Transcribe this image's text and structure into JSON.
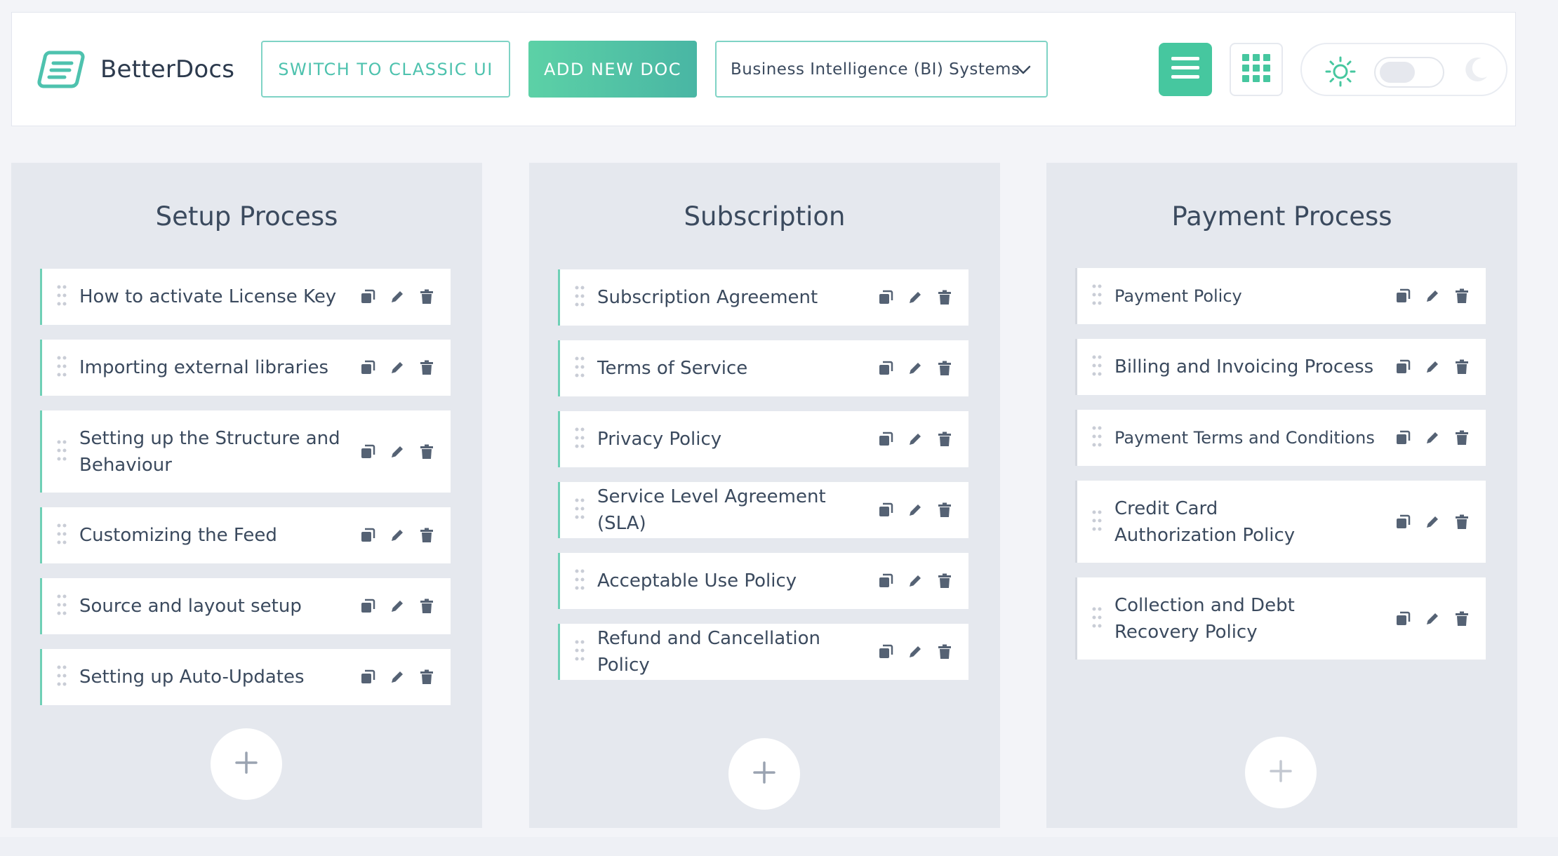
{
  "header": {
    "brand": "BetterDocs",
    "switch_classic_label": "SWITCH TO CLASSIC UI",
    "add_new_doc_label": "ADD NEW DOC",
    "knowledge_base_selected": "Business Intelligence (BI) Systems"
  },
  "colors": {
    "accent": "#46c79f",
    "accent_light": "#7fd3c5",
    "column_bg": "#e5e8ee",
    "page_bg": "#f3f4f8"
  },
  "icons": {
    "logo": "betterdocs-logo-icon",
    "list_view": "list-view-icon",
    "grid_view": "grid-view-icon",
    "light_mode": "sun-icon",
    "dark_mode": "moon-icon",
    "drag": "drag-handle-icon",
    "duplicate": "copy-icon",
    "edit": "pencil-icon",
    "delete": "trash-icon",
    "add": "plus-icon"
  },
  "columns": [
    {
      "title": "Setup Process",
      "docs": [
        "How to activate License Key",
        "Importing external libraries",
        "Setting up the Structure and Behaviour",
        "Customizing the Feed",
        "Source and layout setup",
        "Setting up Auto-Updates"
      ]
    },
    {
      "title": "Subscription",
      "docs": [
        "Subscription Agreement",
        "Terms of Service",
        "Privacy Policy",
        "Service Level Agreement (SLA)",
        "Acceptable Use Policy",
        "Refund and Cancellation Policy"
      ]
    },
    {
      "title": "Payment Process",
      "docs": [
        "Payment Policy",
        "Billing and Invoicing Process",
        "Payment Terms and Conditions",
        "Credit Card Authorization Policy",
        "Collection and Debt Recovery Policy"
      ]
    }
  ]
}
